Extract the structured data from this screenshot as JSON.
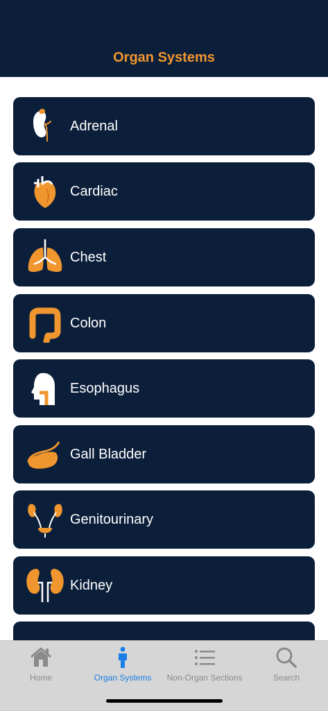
{
  "header": {
    "title": "Organ Systems"
  },
  "accent_color": "#f0962e",
  "navy_color": "#0c1f3a",
  "systems": [
    {
      "label": "Adrenal",
      "icon": "adrenal-icon"
    },
    {
      "label": "Cardiac",
      "icon": "heart-icon"
    },
    {
      "label": "Chest",
      "icon": "lungs-icon"
    },
    {
      "label": "Colon",
      "icon": "colon-icon"
    },
    {
      "label": "Esophagus",
      "icon": "head-esophagus-icon"
    },
    {
      "label": "Gall Bladder",
      "icon": "gallbladder-icon"
    },
    {
      "label": "Genitourinary",
      "icon": "urinary-tract-icon"
    },
    {
      "label": "Kidney",
      "icon": "kidneys-icon"
    },
    {
      "label": "",
      "icon": ""
    }
  ],
  "tabs": [
    {
      "label": "Home",
      "icon": "home-icon",
      "active": false
    },
    {
      "label": "Organ Systems",
      "icon": "person-icon",
      "active": true
    },
    {
      "label": "Non-Organ Sections",
      "icon": "list-icon",
      "active": false
    },
    {
      "label": "Search",
      "icon": "search-icon",
      "active": false
    }
  ]
}
